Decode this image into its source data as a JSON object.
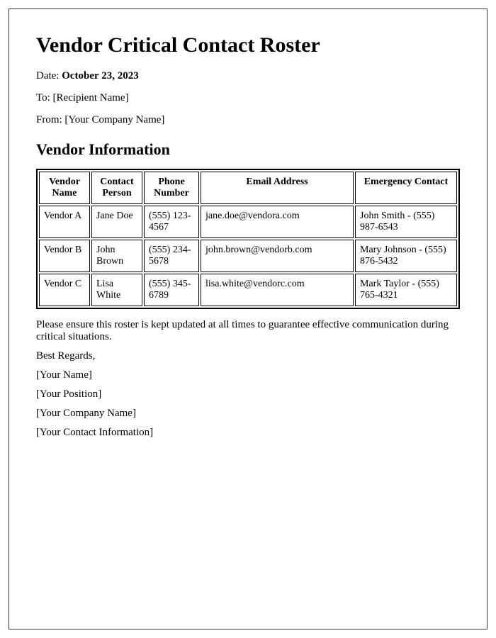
{
  "title": "Vendor Critical Contact Roster",
  "meta": {
    "date_label": "Date: ",
    "date_value": "October 23, 2023",
    "to_line": "To: [Recipient Name]",
    "from_line": "From: [Your Company Name]"
  },
  "section_heading": "Vendor Information",
  "table": {
    "headers": {
      "vendor": "Vendor Name",
      "contact": "Contact Person",
      "phone": "Phone Number",
      "email": "Email Address",
      "emergency": "Emergency Contact"
    },
    "rows": [
      {
        "vendor": "Vendor A",
        "contact": "Jane Doe",
        "phone": "(555) 123-4567",
        "email": "jane.doe@vendora.com",
        "emergency": "John Smith - (555) 987-6543"
      },
      {
        "vendor": "Vendor B",
        "contact": "John Brown",
        "phone": "(555) 234-5678",
        "email": "john.brown@vendorb.com",
        "emergency": "Mary Johnson - (555) 876-5432"
      },
      {
        "vendor": "Vendor C",
        "contact": "Lisa White",
        "phone": "(555) 345-6789",
        "email": "lisa.white@vendorc.com",
        "emergency": "Mark Taylor - (555) 765-4321"
      }
    ]
  },
  "notice": "Please ensure this roster is kept updated at all times to guarantee effective communication during critical situations.",
  "signoff": {
    "regards": "Best Regards,",
    "name": "[Your Name]",
    "position": "[Your Position]",
    "company": "[Your Company Name]",
    "contact": "[Your Contact Information]"
  }
}
